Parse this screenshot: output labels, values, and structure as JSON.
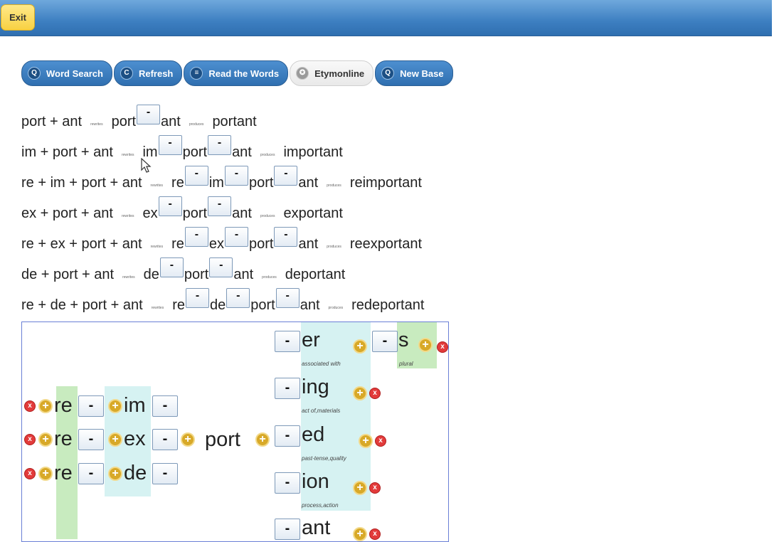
{
  "exit_label": "Exit",
  "toolbar": [
    {
      "label": "Word Search",
      "icon": "search-icon",
      "glyph": "Q"
    },
    {
      "label": "Refresh",
      "icon": "refresh-icon",
      "glyph": "C"
    },
    {
      "label": "Read the Words",
      "icon": "list-icon",
      "glyph": "≡"
    },
    {
      "label": "Etymonline",
      "icon": "star-icon",
      "glyph": "✪"
    },
    {
      "label": "New Base",
      "icon": "search-icon",
      "glyph": "Q"
    }
  ],
  "lines": [
    {
      "sum": "port + ant",
      "rewrites": "rewrites",
      "parts": [
        "port",
        "ant"
      ],
      "produces": "produces",
      "result": "portant"
    },
    {
      "sum": "im + port + ant",
      "rewrites": "rewrites",
      "parts": [
        "im",
        "port",
        "ant"
      ],
      "produces": "produces",
      "result": "important"
    },
    {
      "sum": "re + im + port + ant",
      "rewrites": "rewrites",
      "parts": [
        "re",
        "im",
        "port",
        "ant"
      ],
      "produces": "produces",
      "result": "reimportant"
    },
    {
      "sum": "ex + port + ant",
      "rewrites": "rewrites",
      "parts": [
        "ex",
        "port",
        "ant"
      ],
      "produces": "produces",
      "result": "exportant"
    },
    {
      "sum": "re + ex + port + ant",
      "rewrites": "rewrites",
      "parts": [
        "re",
        "ex",
        "port",
        "ant"
      ],
      "produces": "produces",
      "result": "reexportant"
    },
    {
      "sum": "de + port + ant",
      "rewrites": "rewrites",
      "parts": [
        "de",
        "port",
        "ant"
      ],
      "produces": "produces",
      "result": "deportant"
    },
    {
      "sum": "re + de + port + ant",
      "rewrites": "rewrites",
      "parts": [
        "re",
        "de",
        "port",
        "ant"
      ],
      "produces": "produces",
      "result": "redeportant"
    }
  ],
  "minus": "-",
  "plus": "+",
  "x": "x",
  "matrix": {
    "base": "port",
    "prefix_rows": [
      {
        "outer": "re",
        "inner": "im"
      },
      {
        "outer": "re",
        "inner": "ex"
      },
      {
        "outer": "re",
        "inner": "de"
      }
    ],
    "suffixes": [
      {
        "text": "er",
        "label": "associated with"
      },
      {
        "text": "ing",
        "label": "act of,materials"
      },
      {
        "text": "ed",
        "label": "past-tense,quality"
      },
      {
        "text": "ion",
        "label": "process,action"
      },
      {
        "text": "ant",
        "label": ""
      }
    ],
    "second_suffix": {
      "text": "s",
      "label": "plural"
    }
  }
}
